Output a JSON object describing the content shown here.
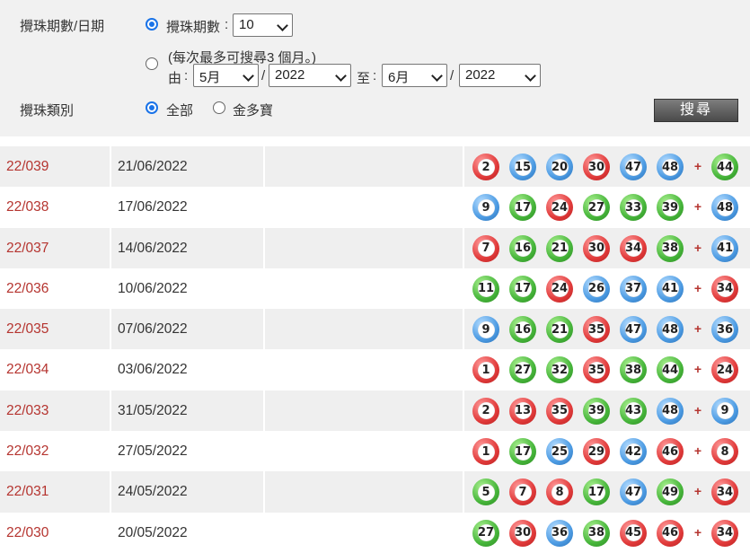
{
  "filter": {
    "draw_label": "攪珠期數/日期",
    "category_label": "攪珠類別",
    "opt_by_count_label": "攪珠期數",
    "colon": ":",
    "count_value": "10",
    "note": "(每次最多可搜尋3 個月。)",
    "from_label": "由",
    "from_month": "5月",
    "from_year": "2022",
    "to_label": "至",
    "to_month": "6月",
    "to_year": "2022",
    "slash": "/",
    "cat_all": "全部",
    "cat_snowball": "金多寶",
    "search_button": "搜尋"
  },
  "colors": {
    "red": "#e13a3a",
    "blue": "#4c9be3",
    "green": "#46b53a",
    "draw_no": "#b5342f"
  },
  "results": [
    {
      "no": "22/039",
      "date": "21/06/2022",
      "balls": [
        [
          "2",
          "red"
        ],
        [
          "15",
          "blue"
        ],
        [
          "20",
          "blue"
        ],
        [
          "30",
          "red"
        ],
        [
          "47",
          "blue"
        ],
        [
          "48",
          "blue"
        ]
      ],
      "extra": [
        "44",
        "green"
      ]
    },
    {
      "no": "22/038",
      "date": "17/06/2022",
      "balls": [
        [
          "9",
          "blue"
        ],
        [
          "17",
          "green"
        ],
        [
          "24",
          "red"
        ],
        [
          "27",
          "green"
        ],
        [
          "33",
          "green"
        ],
        [
          "39",
          "green"
        ]
      ],
      "extra": [
        "48",
        "blue"
      ]
    },
    {
      "no": "22/037",
      "date": "14/06/2022",
      "balls": [
        [
          "7",
          "red"
        ],
        [
          "16",
          "green"
        ],
        [
          "21",
          "green"
        ],
        [
          "30",
          "red"
        ],
        [
          "34",
          "red"
        ],
        [
          "38",
          "green"
        ]
      ],
      "extra": [
        "41",
        "blue"
      ]
    },
    {
      "no": "22/036",
      "date": "10/06/2022",
      "balls": [
        [
          "11",
          "green"
        ],
        [
          "17",
          "green"
        ],
        [
          "24",
          "red"
        ],
        [
          "26",
          "blue"
        ],
        [
          "37",
          "blue"
        ],
        [
          "41",
          "blue"
        ]
      ],
      "extra": [
        "34",
        "red"
      ]
    },
    {
      "no": "22/035",
      "date": "07/06/2022",
      "balls": [
        [
          "9",
          "blue"
        ],
        [
          "16",
          "green"
        ],
        [
          "21",
          "green"
        ],
        [
          "35",
          "red"
        ],
        [
          "47",
          "blue"
        ],
        [
          "48",
          "blue"
        ]
      ],
      "extra": [
        "36",
        "blue"
      ]
    },
    {
      "no": "22/034",
      "date": "03/06/2022",
      "balls": [
        [
          "1",
          "red"
        ],
        [
          "27",
          "green"
        ],
        [
          "32",
          "green"
        ],
        [
          "35",
          "red"
        ],
        [
          "38",
          "green"
        ],
        [
          "44",
          "green"
        ]
      ],
      "extra": [
        "24",
        "red"
      ]
    },
    {
      "no": "22/033",
      "date": "31/05/2022",
      "balls": [
        [
          "2",
          "red"
        ],
        [
          "13",
          "red"
        ],
        [
          "35",
          "red"
        ],
        [
          "39",
          "green"
        ],
        [
          "43",
          "green"
        ],
        [
          "48",
          "blue"
        ]
      ],
      "extra": [
        "9",
        "blue"
      ]
    },
    {
      "no": "22/032",
      "date": "27/05/2022",
      "balls": [
        [
          "1",
          "red"
        ],
        [
          "17",
          "green"
        ],
        [
          "25",
          "blue"
        ],
        [
          "29",
          "red"
        ],
        [
          "42",
          "blue"
        ],
        [
          "46",
          "red"
        ]
      ],
      "extra": [
        "8",
        "red"
      ]
    },
    {
      "no": "22/031",
      "date": "24/05/2022",
      "balls": [
        [
          "5",
          "green"
        ],
        [
          "7",
          "red"
        ],
        [
          "8",
          "red"
        ],
        [
          "17",
          "green"
        ],
        [
          "47",
          "blue"
        ],
        [
          "49",
          "green"
        ]
      ],
      "extra": [
        "34",
        "red"
      ]
    },
    {
      "no": "22/030",
      "date": "20/05/2022",
      "balls": [
        [
          "27",
          "green"
        ],
        [
          "30",
          "red"
        ],
        [
          "36",
          "blue"
        ],
        [
          "38",
          "green"
        ],
        [
          "45",
          "red"
        ],
        [
          "46",
          "red"
        ]
      ],
      "extra": [
        "34",
        "red"
      ]
    }
  ]
}
